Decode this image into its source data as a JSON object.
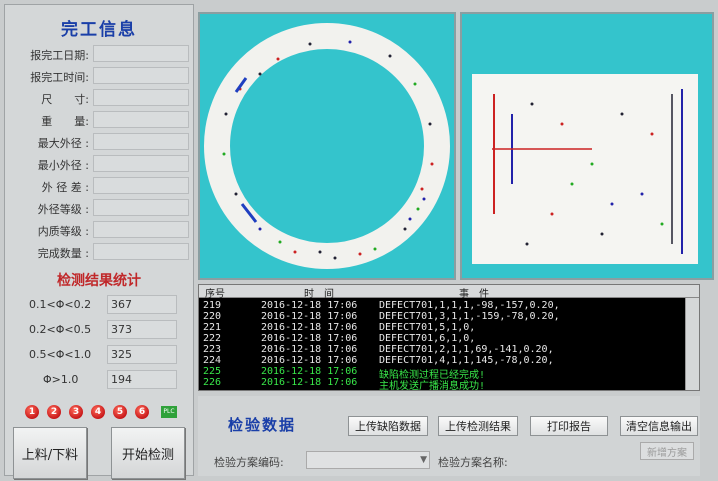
{
  "finish_info": {
    "title": "完工信息",
    "fields": [
      {
        "label": "报完工日期:"
      },
      {
        "label": "报完工时间:"
      },
      {
        "label": "尺　　寸:"
      },
      {
        "label": "重　　量:"
      },
      {
        "label": "最大外径 :"
      },
      {
        "label": "最小外径 :"
      },
      {
        "label": "外 径 差 :"
      },
      {
        "label": "外径等级 :"
      },
      {
        "label": "内质等级 :"
      },
      {
        "label": "完成数量 :"
      }
    ]
  },
  "stats": {
    "title": "检测结果统计",
    "rows": [
      {
        "label": "0.1<Φ<0.2",
        "value": "367"
      },
      {
        "label": "0.2<Φ<0.5",
        "value": "373"
      },
      {
        "label": "0.5<Φ<1.0",
        "value": "325"
      },
      {
        "label": "Φ>1.0",
        "value": "194"
      }
    ]
  },
  "lamps": [
    "1",
    "2",
    "3",
    "4",
    "5",
    "6"
  ],
  "plc_label": "PLC",
  "buttons": {
    "load_unload": "上料/下料",
    "start_detect": "开始检测",
    "upload_defect": "上传缺陷数据",
    "upload_result": "上传检测结果",
    "print_report": "打印报告",
    "clear_output": "清空信息输出",
    "disabled_btn": "新增方案"
  },
  "log": {
    "headers": {
      "seq": "序号",
      "time": "时　间",
      "event": "事　件"
    },
    "rows": [
      {
        "seq": "219",
        "time": "2016-12-18 17:06",
        "event": "DEFECT701,1,1,1,-98,-157,0.20,",
        "color": "#e8e8e8"
      },
      {
        "seq": "220",
        "time": "2016-12-18 17:06",
        "event": "DEFECT701,3,1,1,-159,-78,0.20,",
        "color": "#e8e8e8"
      },
      {
        "seq": "221",
        "time": "2016-12-18 17:06",
        "event": "DEFECT701,5,1,0,",
        "color": "#e8e8e8"
      },
      {
        "seq": "222",
        "time": "2016-12-18 17:06",
        "event": "DEFECT701,6,1,0,",
        "color": "#e8e8e8"
      },
      {
        "seq": "223",
        "time": "2016-12-18 17:06",
        "event": "DEFECT701,2,1,1,69,-141,0.20,",
        "color": "#e8e8e8"
      },
      {
        "seq": "224",
        "time": "2016-12-18 17:06",
        "event": "DEFECT701,4,1,1,145,-78,0.20,",
        "color": "#e8e8e8"
      },
      {
        "seq": "225",
        "time": "2016-12-18 17:06",
        "event": "缺陷检测过程已经完成!",
        "color": "#39e84a"
      },
      {
        "seq": "226",
        "time": "2016-12-18 17:06",
        "event": "主机发送广播消息成功!",
        "color": "#39e84a"
      }
    ]
  },
  "inspection": {
    "title": "检验数据",
    "scheme_code_label": "检验方案编码:",
    "scheme_name_label": "检验方案名称:"
  },
  "colors": {
    "view_bg": "#34c4cc",
    "title_blue": "#1a3fa8",
    "stats_red": "#c0282a",
    "log_green": "#39e84a"
  }
}
